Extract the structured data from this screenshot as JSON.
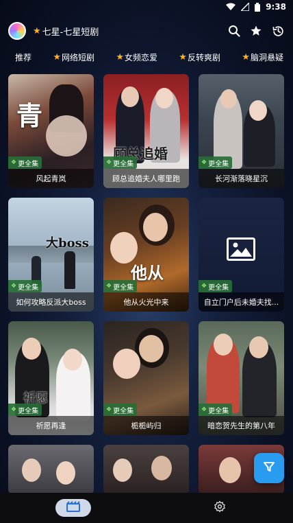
{
  "status_bar": {
    "time": "9:38"
  },
  "header": {
    "title": "七星-七星短剧",
    "title_star": "★"
  },
  "tabs": [
    {
      "label": "推荐",
      "star": ""
    },
    {
      "label": "网络短剧",
      "star": "★"
    },
    {
      "label": "女频恋爱",
      "star": "★"
    },
    {
      "label": "反转爽剧",
      "star": "★"
    },
    {
      "label": "脑洞悬疑",
      "star": "★"
    }
  ],
  "badge_label": "更全集",
  "cards": [
    {
      "title": "风起青岚",
      "poster_text": "青"
    },
    {
      "title": "顾总追婚夫人哪里跑",
      "poster_text": "顾总追婚"
    },
    {
      "title": "长河渐落晓星沉",
      "poster_text": ""
    },
    {
      "title": "如何攻略反派大boss",
      "poster_text": "大boss"
    },
    {
      "title": "他从火光中来",
      "poster_text": "他从"
    },
    {
      "title": "自立门户后未婚夫找...",
      "poster_text": ""
    },
    {
      "title": "祈愿再逢",
      "poster_text": "祈愿"
    },
    {
      "title": "栀栀屿归",
      "poster_text": ""
    },
    {
      "title": "暗恋贺先生的第八年",
      "poster_text": ""
    }
  ],
  "colors": {
    "accent": "#2a9cf0",
    "star": "#ffb21a",
    "badge": "#286e37"
  },
  "icons": {
    "header": [
      "search-icon",
      "star-icon",
      "history-icon"
    ],
    "bottom": [
      "film-icon",
      "settings-icon"
    ],
    "fab": "filter-icon"
  }
}
